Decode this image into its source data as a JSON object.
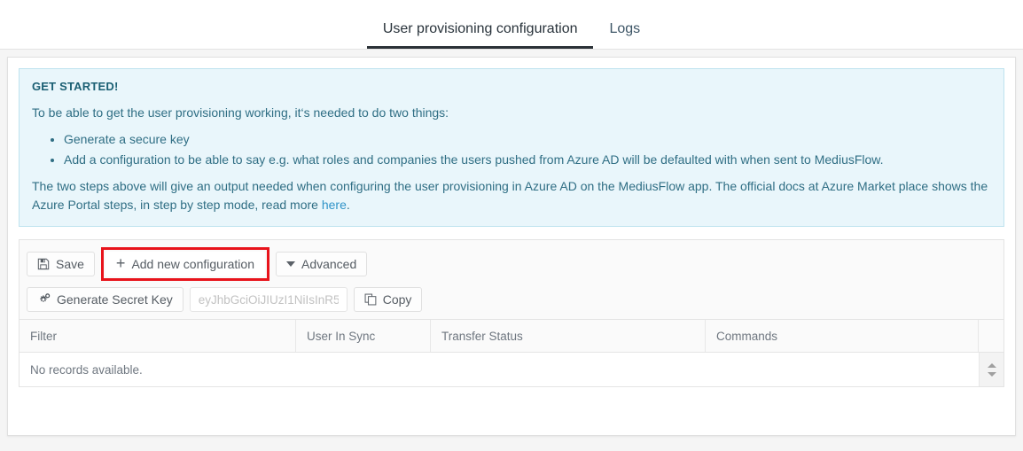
{
  "tabs": [
    {
      "label": "User provisioning configuration",
      "active": true
    },
    {
      "label": "Logs",
      "active": false
    }
  ],
  "infobox": {
    "title": "GET STARTED!",
    "intro": "To be able to get the user provisioning working, it‘s needed to do two things:",
    "bullets": [
      "Generate a secure key",
      "Add a configuration to be able to say e.g. what roles and companies the users pushed from Azure AD will be defaulted with when sent to MediusFlow."
    ],
    "outro_before_link": "The two steps above will give an output needed when configuring the user provisioning in Azure AD on the MediusFlow app. The official docs at Azure Market place shows the Azure Portal steps, in step by step mode, read more ",
    "link_text": "here",
    "outro_after_link": ".",
    "background_color": "#e9f6fb",
    "border_color": "#bfe3ef",
    "text_color": "#2f6e84",
    "title_color": "#1a5f73",
    "link_color": "#2f93c8"
  },
  "toolbar": {
    "save_label": "Save",
    "add_configuration_label": "Add new configuration",
    "advanced_label": "Advanced",
    "generate_secret_key_label": "Generate Secret Key",
    "secret_key_placeholder": "eyJhbGciOiJIUzI1NiIsInR5",
    "secret_key_value": "",
    "copy_label": "Copy",
    "highlight_color": "#e8131b",
    "icons": {
      "save": "floppy-disk-icon",
      "add": "plus-icon",
      "advanced": "caret-down-icon",
      "generate": "cogs-icon",
      "copy": "copy-icon"
    }
  },
  "grid": {
    "columns": [
      "Filter",
      "User In Sync",
      "Transfer Status",
      "Commands"
    ],
    "rows": [],
    "empty_message": "No records available.",
    "scroll_up_icon": "triangle-up-icon",
    "scroll_down_icon": "triangle-down-icon"
  }
}
